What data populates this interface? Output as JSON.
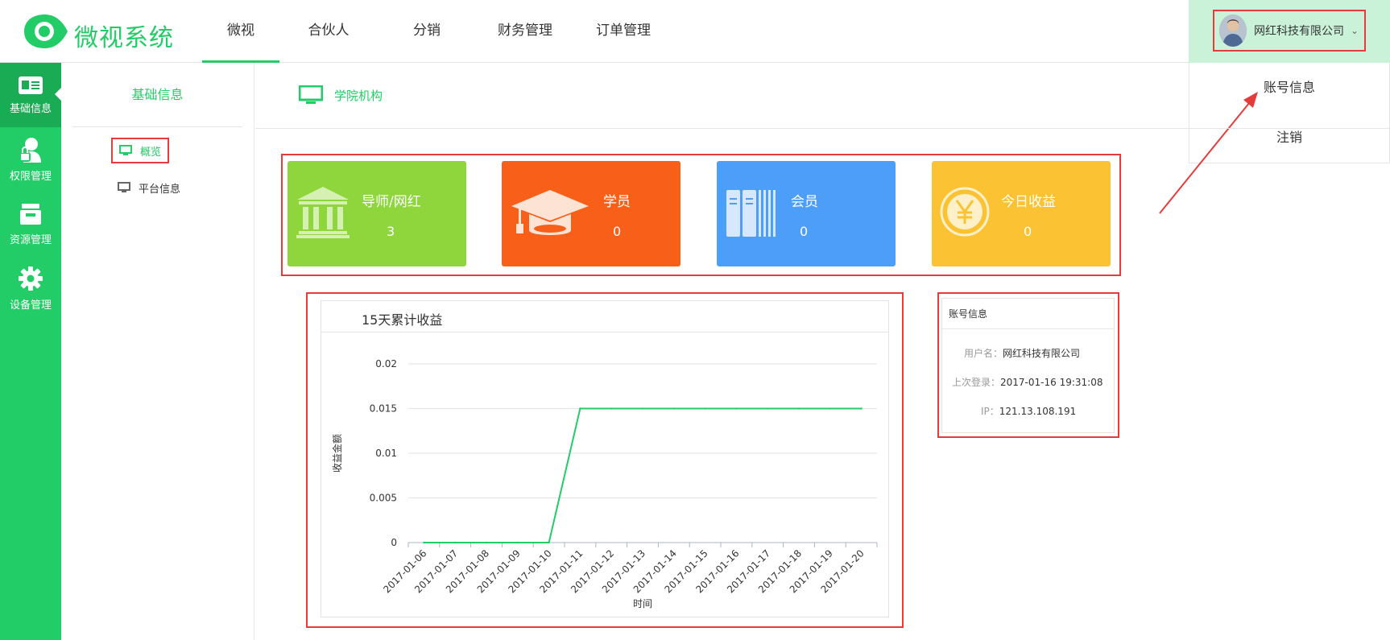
{
  "app": {
    "title": "微视系统"
  },
  "nav": {
    "items": [
      "微视",
      "合伙人",
      "分销",
      "财务管理",
      "订单管理"
    ],
    "active": 0
  },
  "user": {
    "company": "网红科技有限公司"
  },
  "dropdown": {
    "items": [
      "账号信息",
      "注销"
    ]
  },
  "sidebar": {
    "items": [
      {
        "label": "基础信息",
        "icon": "id-card-icon"
      },
      {
        "label": "权限管理",
        "icon": "user-lock-icon"
      },
      {
        "label": "资源管理",
        "icon": "archive-icon"
      },
      {
        "label": "设备管理",
        "icon": "gear-icon"
      }
    ]
  },
  "submenu": {
    "title": "基础信息",
    "items": [
      "概览",
      "平台信息"
    ]
  },
  "content": {
    "heading": "学院机构"
  },
  "cards": [
    {
      "label": "导师/网红",
      "value": "3",
      "color": "#8ed63c",
      "icon": "institution-icon"
    },
    {
      "label": "学员",
      "value": "0",
      "color": "#f8601a",
      "icon": "graduation-cap-icon"
    },
    {
      "label": "会员",
      "value": "0",
      "color": "#4d9ef8",
      "icon": "books-icon"
    },
    {
      "label": "今日收益",
      "value": "0",
      "color": "#fbc334",
      "icon": "yen-coin-icon"
    }
  ],
  "account": {
    "title": "账号信息",
    "rows": [
      {
        "key": "用户名：",
        "value": "网红科技有限公司"
      },
      {
        "key": "上次登录：",
        "value": "2017-01-16 19:31:08"
      },
      {
        "key": "IP：",
        "value": "121.13.108.191"
      }
    ]
  },
  "chart_data": {
    "type": "line",
    "title": "15天累计收益",
    "xlabel": "时间",
    "ylabel": "收益金额",
    "x": [
      "2017-01-06",
      "2017-01-07",
      "2017-01-08",
      "2017-01-09",
      "2017-01-10",
      "2017-01-11",
      "2017-01-12",
      "2017-01-13",
      "2017-01-14",
      "2017-01-15",
      "2017-01-16",
      "2017-01-17",
      "2017-01-18",
      "2017-01-19",
      "2017-01-20"
    ],
    "values": [
      0,
      0,
      0,
      0,
      0,
      0.015,
      0.015,
      0.015,
      0.015,
      0.015,
      0.015,
      0.015,
      0.015,
      0.015,
      0.015
    ],
    "yticks": [
      "0",
      "0.005",
      "0.01",
      "0.015",
      "0.02"
    ],
    "ylim": [
      0,
      0.02
    ],
    "grid": true,
    "line_color": "#22cc66"
  }
}
